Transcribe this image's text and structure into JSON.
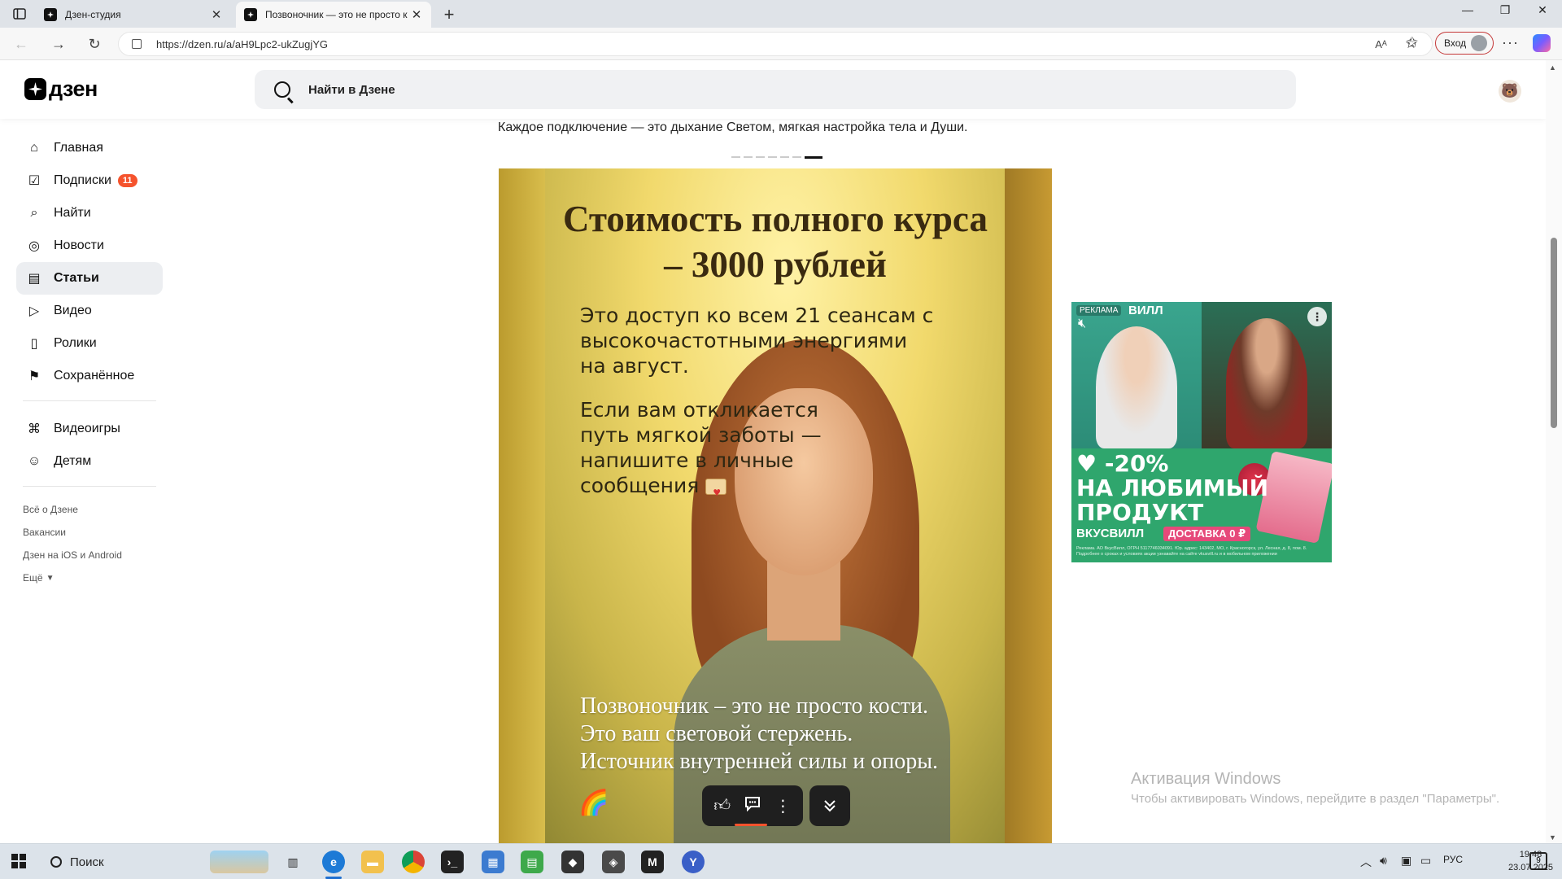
{
  "browser": {
    "tabs": [
      {
        "title": "Дзен-студия",
        "active": false
      },
      {
        "title": "Позвоночник — это не просто к",
        "active": true
      }
    ],
    "url": "https://dzen.ru/a/aH9Lpc2-ukZugjYG",
    "read_aloud_label": "Aᴬ",
    "login_label": "Вход"
  },
  "header": {
    "logo_text": "дзен",
    "search_placeholder": "Найти в Дзене"
  },
  "sidebar": {
    "items": [
      {
        "label": "Главная",
        "icon": "home-icon",
        "glyph": "⌂"
      },
      {
        "label": "Подписки",
        "icon": "subscriptions-icon",
        "glyph": "☑",
        "badge": "11"
      },
      {
        "label": "Найти",
        "icon": "search-icon",
        "glyph": "⌕"
      },
      {
        "label": "Новости",
        "icon": "news-icon",
        "glyph": "◎"
      },
      {
        "label": "Статьи",
        "icon": "articles-icon",
        "glyph": "▤",
        "active": true
      },
      {
        "label": "Видео",
        "icon": "video-icon",
        "glyph": "▷"
      },
      {
        "label": "Ролики",
        "icon": "shorts-icon",
        "glyph": "▯"
      },
      {
        "label": "Сохранённое",
        "icon": "bookmark-icon",
        "glyph": "⚑"
      }
    ],
    "items2": [
      {
        "label": "Видеоигры",
        "icon": "gamepad-icon",
        "glyph": "⌘"
      },
      {
        "label": "Детям",
        "icon": "kids-icon",
        "glyph": "☺"
      }
    ],
    "links": [
      "Всё о Дзене",
      "Вакансии",
      "Дзен на iOS и Android",
      "Ещё"
    ]
  },
  "article": {
    "lead": "Каждое подключение — это дыхание Светом, мягкая настройка тела и Души.",
    "carousel_total": 7,
    "carousel_active": 7,
    "image": {
      "heading_line1": "Стоимость полного курса",
      "heading_line2": "– 3000 рублей",
      "para1": "Это доступ ко всем 21 сеансам с высокочастотными энергиями на август.",
      "para2": "Если вам откликается путь мягкой заботы — напишите в личные сообщения",
      "bottom_line1": "Позвоночник – это не просто кости.",
      "bottom_line2": "Это ваш световой стержень.",
      "bottom_line3": "Источник внутренней силы и опоры.",
      "emoji": "🌈"
    }
  },
  "ad": {
    "label": "РЕКЛАМА",
    "brand_top": "ВИЛЛ",
    "headline_line1": "♥ -20%",
    "headline_line2": "НА ЛЮБИМЫЙ",
    "headline_line3": "ПРОДУКТ",
    "brand": "ВКУСВИЛЛ",
    "delivery": "ДОСТАВКА 0 ₽",
    "fine_print": "Реклама. АО ВкусВилл, ОГРН 5117746034091. Юр. адрес: 143402, МО, г. Красногорск, ул. Лесная, д. 8, пом. 8. Подробнее о сроках и условиях акции узнавайте на сайте vkusvill.ru и в мобильном приложении"
  },
  "watermark": {
    "title": "Активация Windows",
    "subtitle": "Чтобы активировать Windows, перейдите в раздел \"Параметры\"."
  },
  "taskbar": {
    "search_label": "Поиск",
    "lang": "РУС",
    "time": "19:48",
    "date": "23.07.2025",
    "notifications": "9"
  },
  "colors": {
    "accent": "#f5532d",
    "active_nav_bg": "#eceef1"
  }
}
